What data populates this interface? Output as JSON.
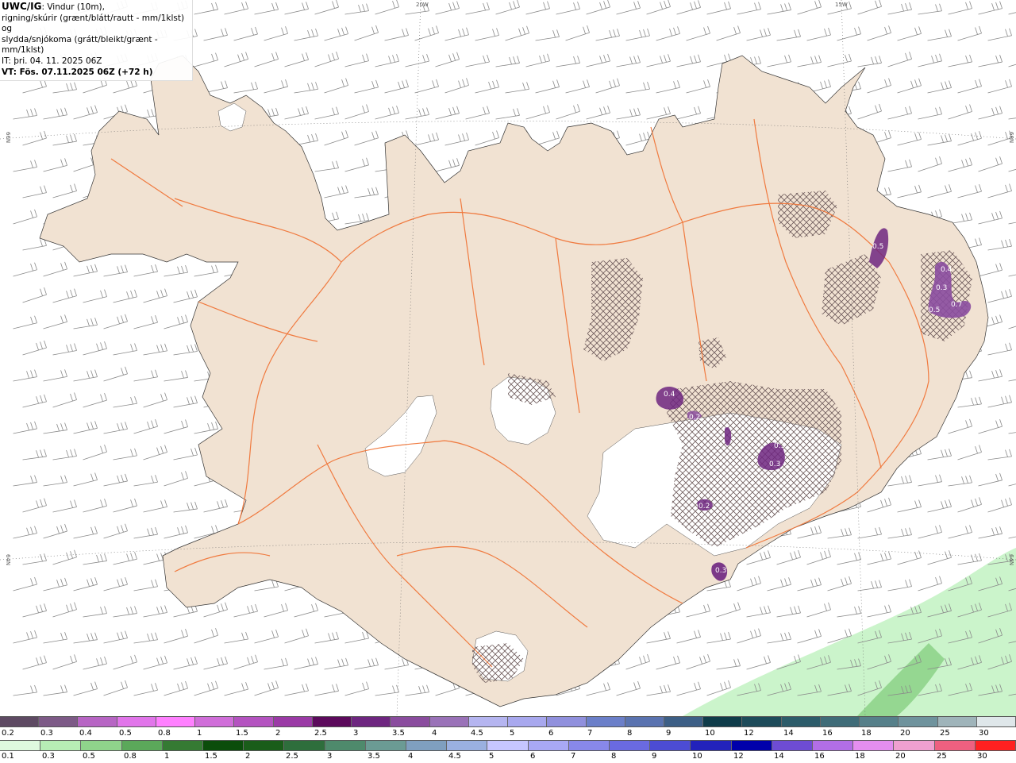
{
  "header": {
    "product": "UWC/IG",
    "desc_line1": ": Vindur (10m),",
    "desc_line2": "rigning/skúrir (grænt/blátt/rautt - mm/1klst) og",
    "desc_line3": "slydda/snjókoma (grátt/bleikt/grænt - mm/1klst)",
    "it_line": "IT: þri. 04. 11. 2025 06Z",
    "vt_line": "VT: Fös. 07.11.2025 06Z (+72 h)"
  },
  "grid_labels": {
    "lon_20": "20W",
    "lon_15": "15W",
    "lat_66_left": "66N",
    "lat_66_right": "66N",
    "lat_64_left": "64N",
    "lat_64_right": "64N"
  },
  "precip_labels": [
    "0.5",
    "0.4",
    "0.3",
    "0.5",
    "0.7",
    "0.4",
    "0.2",
    "0.3",
    "0.3",
    "0.2",
    "0.3"
  ],
  "legend_snow": {
    "labels": [
      "0.2",
      "0.3",
      "0.4",
      "0.5",
      "0.8",
      "1",
      "1.5",
      "2",
      "2.5",
      "3",
      "3.5",
      "4",
      "4.5",
      "5",
      "6",
      "7",
      "8",
      "9",
      "10",
      "12",
      "14",
      "16",
      "18",
      "20",
      "25",
      "30"
    ],
    "colors": [
      "#5e4a63",
      "#7d5a87",
      "#b765c4",
      "#e175ea",
      "#ff80ff",
      "#d06ed9",
      "#b453c0",
      "#9b3aa6",
      "#5c0a5c",
      "#6e2680",
      "#8a4c9e",
      "#9a72b8",
      "#b5b5f0",
      "#a8a8ee",
      "#9090dd",
      "#6b7fc9",
      "#5a73b0",
      "#3d5f86",
      "#0f3c4a",
      "#1d4b5a",
      "#2c5c6a",
      "#3f6c78",
      "#56808a",
      "#6f939d",
      "#9fb4ba",
      "#dfe7ea"
    ]
  },
  "legend_rain": {
    "labels": [
      "0.1",
      "0.3",
      "0.5",
      "0.8",
      "1",
      "1.5",
      "2",
      "2.5",
      "3",
      "3.5",
      "4",
      "4.5",
      "5",
      "6",
      "7",
      "8",
      "9",
      "10",
      "12",
      "14",
      "16",
      "18",
      "20",
      "25",
      "30"
    ],
    "colors": [
      "#dff9df",
      "#b7edb5",
      "#8fd48b",
      "#5ba85a",
      "#357a33",
      "#0b4d0b",
      "#1a5d1a",
      "#2e6e3c",
      "#4e8a6c",
      "#6b9b94",
      "#7f9fbf",
      "#9ab0e0",
      "#c6c6ff",
      "#a8a8f5",
      "#8888ea",
      "#6a6ae0",
      "#4c4cd4",
      "#2222bb",
      "#0000aa",
      "#6e4cd4",
      "#b26ee6",
      "#e48ef0",
      "#f0a0d0",
      "#ee6080",
      "#ff2020"
    ]
  },
  "layers": {
    "wind_barbs": "wind-barbs-10m",
    "roads": "roads",
    "glaciers": "glaciers",
    "land_color": "#f1e2d2",
    "road_color": "#f07538",
    "sea_rain_color": "#c4f2c4"
  }
}
